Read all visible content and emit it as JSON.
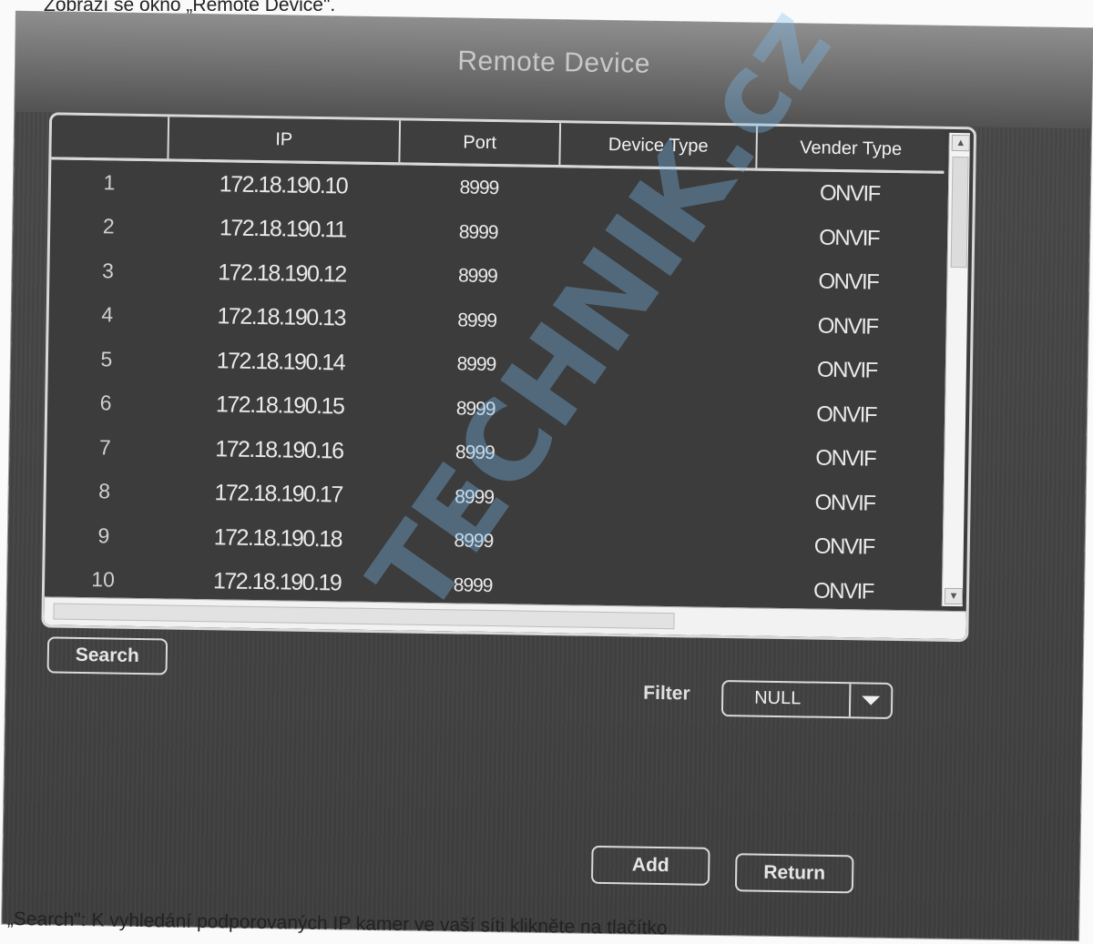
{
  "caption_top": "Zobrazí se okno „Remote Device\".",
  "caption_bottom": "„Search\": K vyhledání podporovaných IP kamer ve vaší síti klikněte na tlačítko",
  "window": {
    "title": "Remote Device"
  },
  "table": {
    "columns": [
      "",
      "IP",
      "Port",
      "Device Type",
      "Vender Type"
    ],
    "rows": [
      {
        "num": "1",
        "ip": "172.18.190.10",
        "port": "8999",
        "device_type": "",
        "vendor": "ONVIF"
      },
      {
        "num": "2",
        "ip": "172.18.190.11",
        "port": "8999",
        "device_type": "",
        "vendor": "ONVIF"
      },
      {
        "num": "3",
        "ip": "172.18.190.12",
        "port": "8999",
        "device_type": "",
        "vendor": "ONVIF"
      },
      {
        "num": "4",
        "ip": "172.18.190.13",
        "port": "8999",
        "device_type": "",
        "vendor": "ONVIF"
      },
      {
        "num": "5",
        "ip": "172.18.190.14",
        "port": "8999",
        "device_type": "",
        "vendor": "ONVIF"
      },
      {
        "num": "6",
        "ip": "172.18.190.15",
        "port": "8999",
        "device_type": "",
        "vendor": "ONVIF"
      },
      {
        "num": "7",
        "ip": "172.18.190.16",
        "port": "8999",
        "device_type": "",
        "vendor": "ONVIF"
      },
      {
        "num": "8",
        "ip": "172.18.190.17",
        "port": "8999",
        "device_type": "",
        "vendor": "ONVIF"
      },
      {
        "num": "9",
        "ip": "172.18.190.18",
        "port": "8999",
        "device_type": "",
        "vendor": "ONVIF"
      },
      {
        "num": "10",
        "ip": "172.18.190.19",
        "port": "8999",
        "device_type": "",
        "vendor": "ONVIF"
      }
    ]
  },
  "buttons": {
    "search": "Search",
    "add": "Add",
    "return": "Return"
  },
  "filter": {
    "label": "Filter",
    "value": "NULL"
  },
  "watermark": "TECHNIK.cz",
  "colors": {
    "panel": "#444444",
    "border": "#d8d8d8",
    "titlebar": "#7a7a7a",
    "watermark": "#78bef0"
  }
}
